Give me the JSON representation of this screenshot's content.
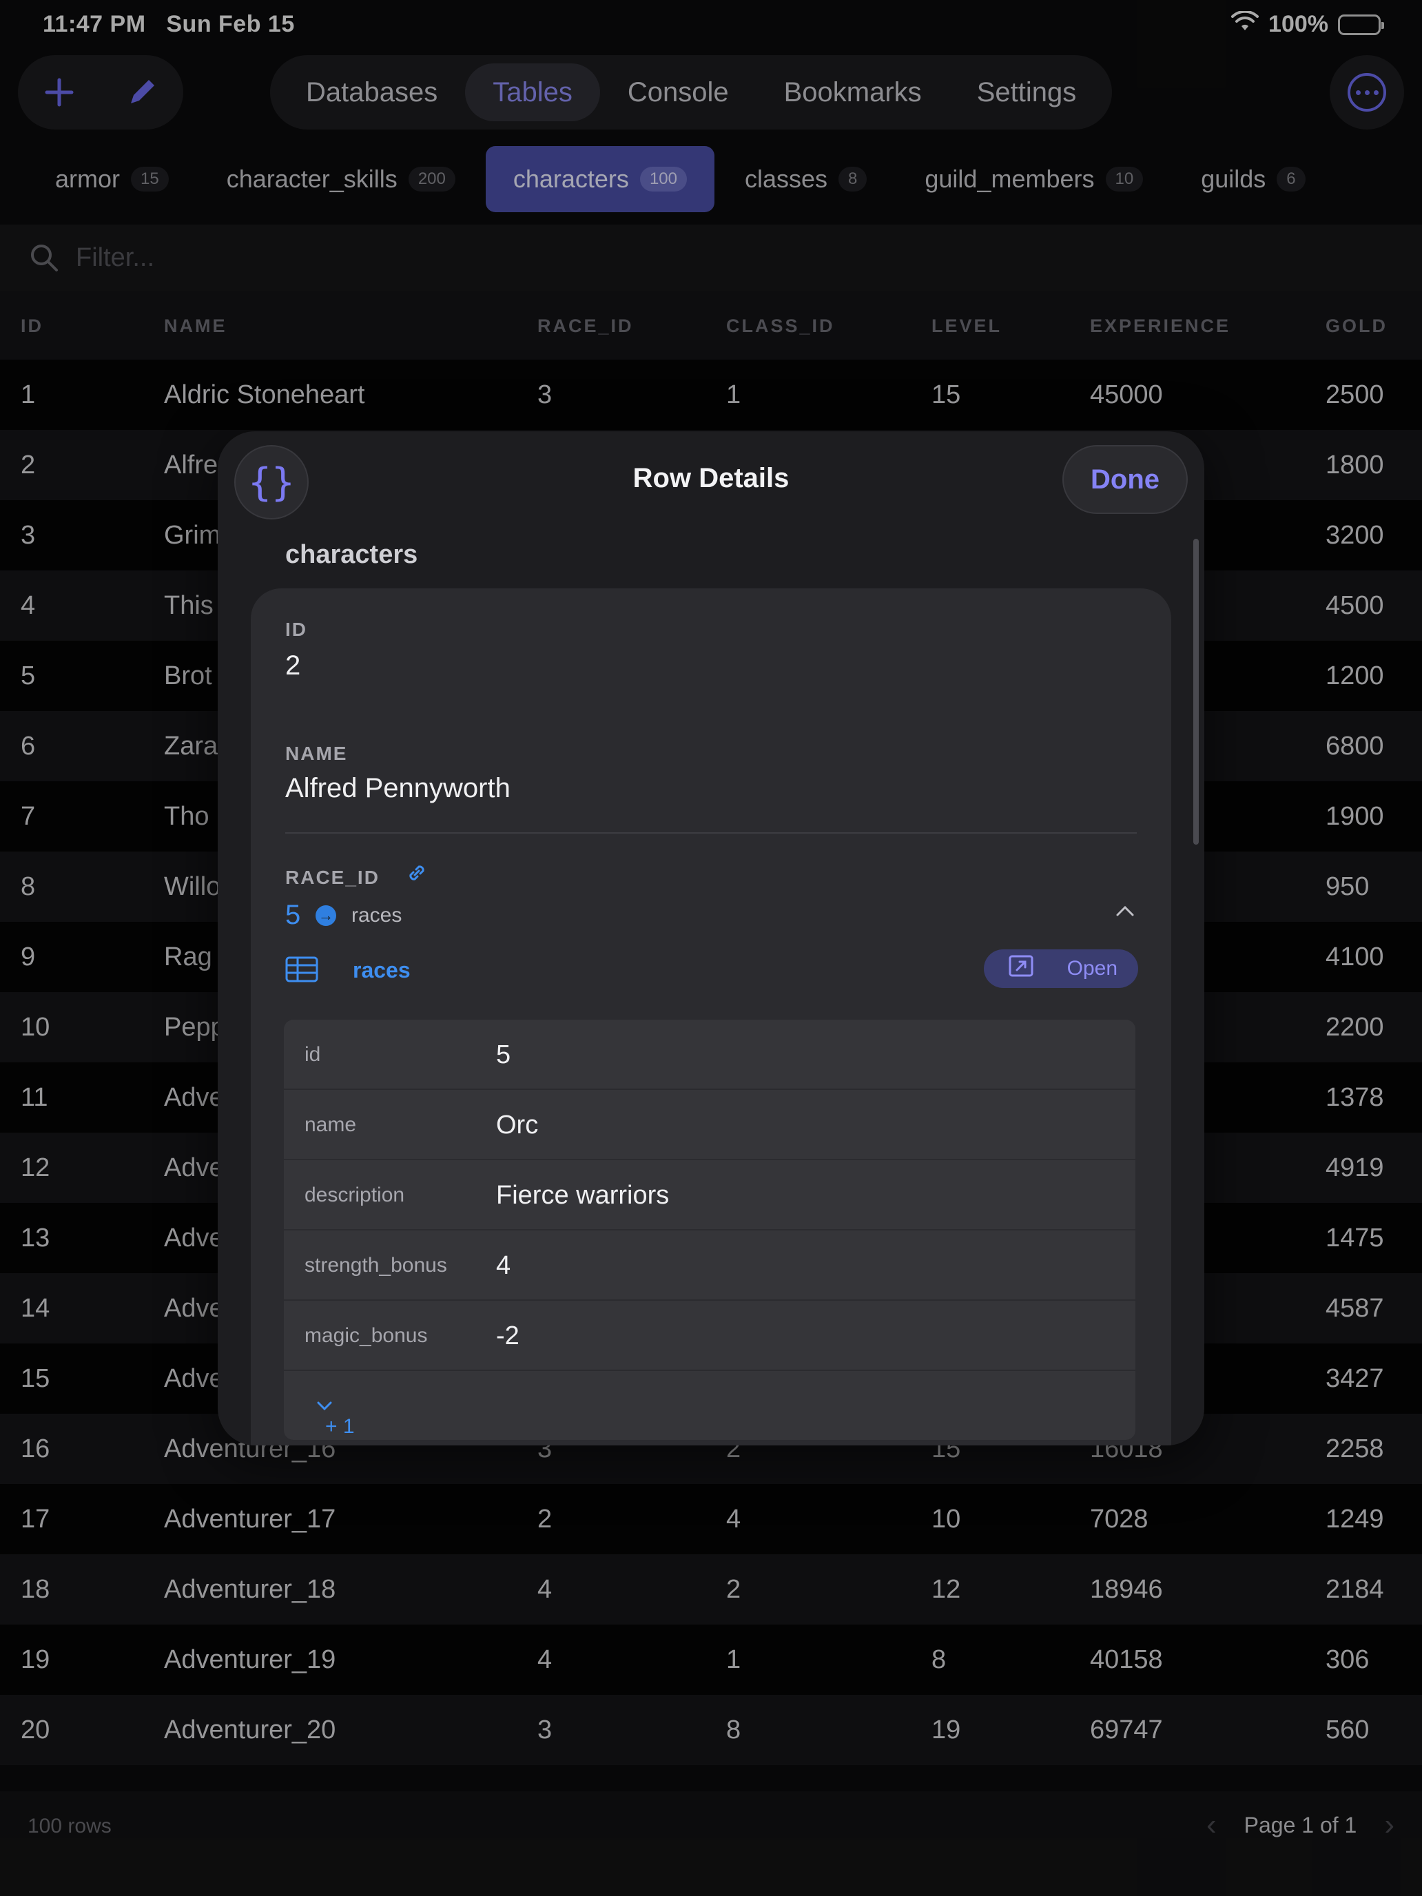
{
  "status": {
    "time": "11:47 PM",
    "date": "Sun Feb 15",
    "battery": "100%"
  },
  "toolbar": {
    "tabs": [
      {
        "label": "Databases",
        "active": false
      },
      {
        "label": "Tables",
        "active": true
      },
      {
        "label": "Console",
        "active": false
      },
      {
        "label": "Bookmarks",
        "active": false
      },
      {
        "label": "Settings",
        "active": false
      }
    ],
    "icons": [
      "plus-icon",
      "pencil-icon",
      "ellipsis-icon"
    ]
  },
  "table_tabs": [
    {
      "name": "armor",
      "count": "15",
      "active": false
    },
    {
      "name": "character_skills",
      "count": "200",
      "active": false
    },
    {
      "name": "characters",
      "count": "100",
      "active": true
    },
    {
      "name": "classes",
      "count": "8",
      "active": false
    },
    {
      "name": "guild_members",
      "count": "10",
      "active": false
    },
    {
      "name": "guilds",
      "count": "6",
      "active": false
    }
  ],
  "filter": {
    "placeholder": "Filter..."
  },
  "grid": {
    "columns": [
      "ID",
      "NAME",
      "RACE_ID",
      "CLASS_ID",
      "LEVEL",
      "EXPERIENCE",
      "GOLD"
    ],
    "rows": [
      [
        "1",
        "Aldric Stoneheart",
        "3",
        "1",
        "15",
        "45000",
        "2500"
      ],
      [
        "2",
        "Alfre",
        "",
        "",
        "",
        "",
        "1800"
      ],
      [
        "3",
        "Grim",
        "",
        "",
        "",
        "",
        "3200"
      ],
      [
        "4",
        "This",
        "",
        "",
        "",
        "",
        "4500"
      ],
      [
        "5",
        "Brot",
        "",
        "",
        "",
        "",
        "1200"
      ],
      [
        "6",
        "Zara",
        "",
        "",
        "",
        "",
        "6800"
      ],
      [
        "7",
        "Tho",
        "",
        "",
        "",
        "",
        "1900"
      ],
      [
        "8",
        "Willo",
        "",
        "",
        "",
        "",
        "950"
      ],
      [
        "9",
        "Rag",
        "",
        "",
        "",
        "",
        "4100"
      ],
      [
        "10",
        "Pepp",
        "",
        "",
        "",
        "",
        "2200"
      ],
      [
        "11",
        "Adve",
        "",
        "",
        "",
        "",
        "1378"
      ],
      [
        "12",
        "Adve",
        "",
        "",
        "",
        "",
        "4919"
      ],
      [
        "13",
        "Adve",
        "",
        "",
        "",
        "",
        "1475"
      ],
      [
        "14",
        "Adve",
        "",
        "",
        "",
        "",
        "4587"
      ],
      [
        "15",
        "Adve",
        "",
        "",
        "",
        "",
        "3427"
      ],
      [
        "16",
        "Adventurer_16",
        "3",
        "2",
        "15",
        "16018",
        "2258"
      ],
      [
        "17",
        "Adventurer_17",
        "2",
        "4",
        "10",
        "7028",
        "1249"
      ],
      [
        "18",
        "Adventurer_18",
        "4",
        "2",
        "12",
        "18946",
        "2184"
      ],
      [
        "19",
        "Adventurer_19",
        "4",
        "1",
        "8",
        "40158",
        "306"
      ],
      [
        "20",
        "Adventurer_20",
        "3",
        "8",
        "19",
        "69747",
        "560"
      ]
    ]
  },
  "footer": {
    "row_count": "100 rows",
    "page": "Page 1 of 1"
  },
  "modal": {
    "json_button": "{}",
    "title": "Row Details",
    "done": "Done",
    "table": "characters",
    "fields": {
      "id": {
        "label": "ID",
        "value": "2"
      },
      "name": {
        "label": "NAME",
        "value": "Alfred Pennyworth"
      },
      "race_id": {
        "label": "RACE_ID",
        "value": "5",
        "ref_table": "races"
      }
    },
    "reference": {
      "table": "races",
      "open": "Open",
      "rows": [
        {
          "key": "id",
          "value": "5"
        },
        {
          "key": "name",
          "value": "Orc"
        },
        {
          "key": "description",
          "value": "Fierce warriors"
        },
        {
          "key": "strength_bonus",
          "value": "4"
        },
        {
          "key": "magic_bonus",
          "value": "-2"
        }
      ],
      "more": "+ 1 more fields"
    }
  }
}
